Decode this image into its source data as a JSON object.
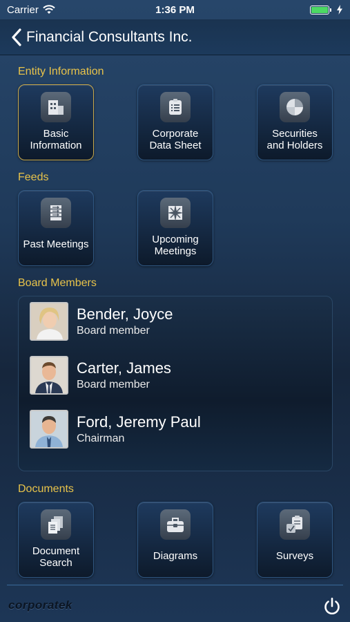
{
  "status_bar": {
    "carrier": "Carrier",
    "time": "1:36 PM"
  },
  "nav": {
    "title": "Financial Consultants Inc."
  },
  "sections": {
    "entity": {
      "title": "Entity Information",
      "tiles": [
        {
          "label_line1": "Basic",
          "label_line2": "Information",
          "icon": "building-icon"
        },
        {
          "label_line1": "Corporate",
          "label_line2": "Data Sheet",
          "icon": "data-sheet-icon"
        },
        {
          "label_line1": "Securities",
          "label_line2": "and Holders",
          "icon": "pie-chart-icon"
        }
      ]
    },
    "feeds": {
      "title": "Feeds",
      "tiles": [
        {
          "label_line1": "Past Meetings",
          "label_line2": "",
          "icon": "list-arrows-icon"
        },
        {
          "label_line1": "Upcoming",
          "label_line2": "Meetings",
          "icon": "compass-star-icon"
        }
      ]
    },
    "board": {
      "title": "Board Members",
      "members": [
        {
          "name": "Bender, Joyce",
          "role": "Board member"
        },
        {
          "name": "Carter, James",
          "role": "Board member"
        },
        {
          "name": "Ford, Jeremy Paul",
          "role": "Chairman"
        }
      ]
    },
    "documents": {
      "title": "Documents",
      "tiles": [
        {
          "label_line1": "Document",
          "label_line2": "Search",
          "icon": "documents-icon"
        },
        {
          "label_line1": "Diagrams",
          "label_line2": "",
          "icon": "toolbox-icon"
        },
        {
          "label_line1": "Surveys",
          "label_line2": "",
          "icon": "clipboard-icon"
        }
      ]
    }
  },
  "footer": {
    "brand": "corporatek"
  },
  "colors": {
    "section_title": "#e8c34a",
    "selected_border": "#c9a94a",
    "battery": "#4cd964"
  }
}
